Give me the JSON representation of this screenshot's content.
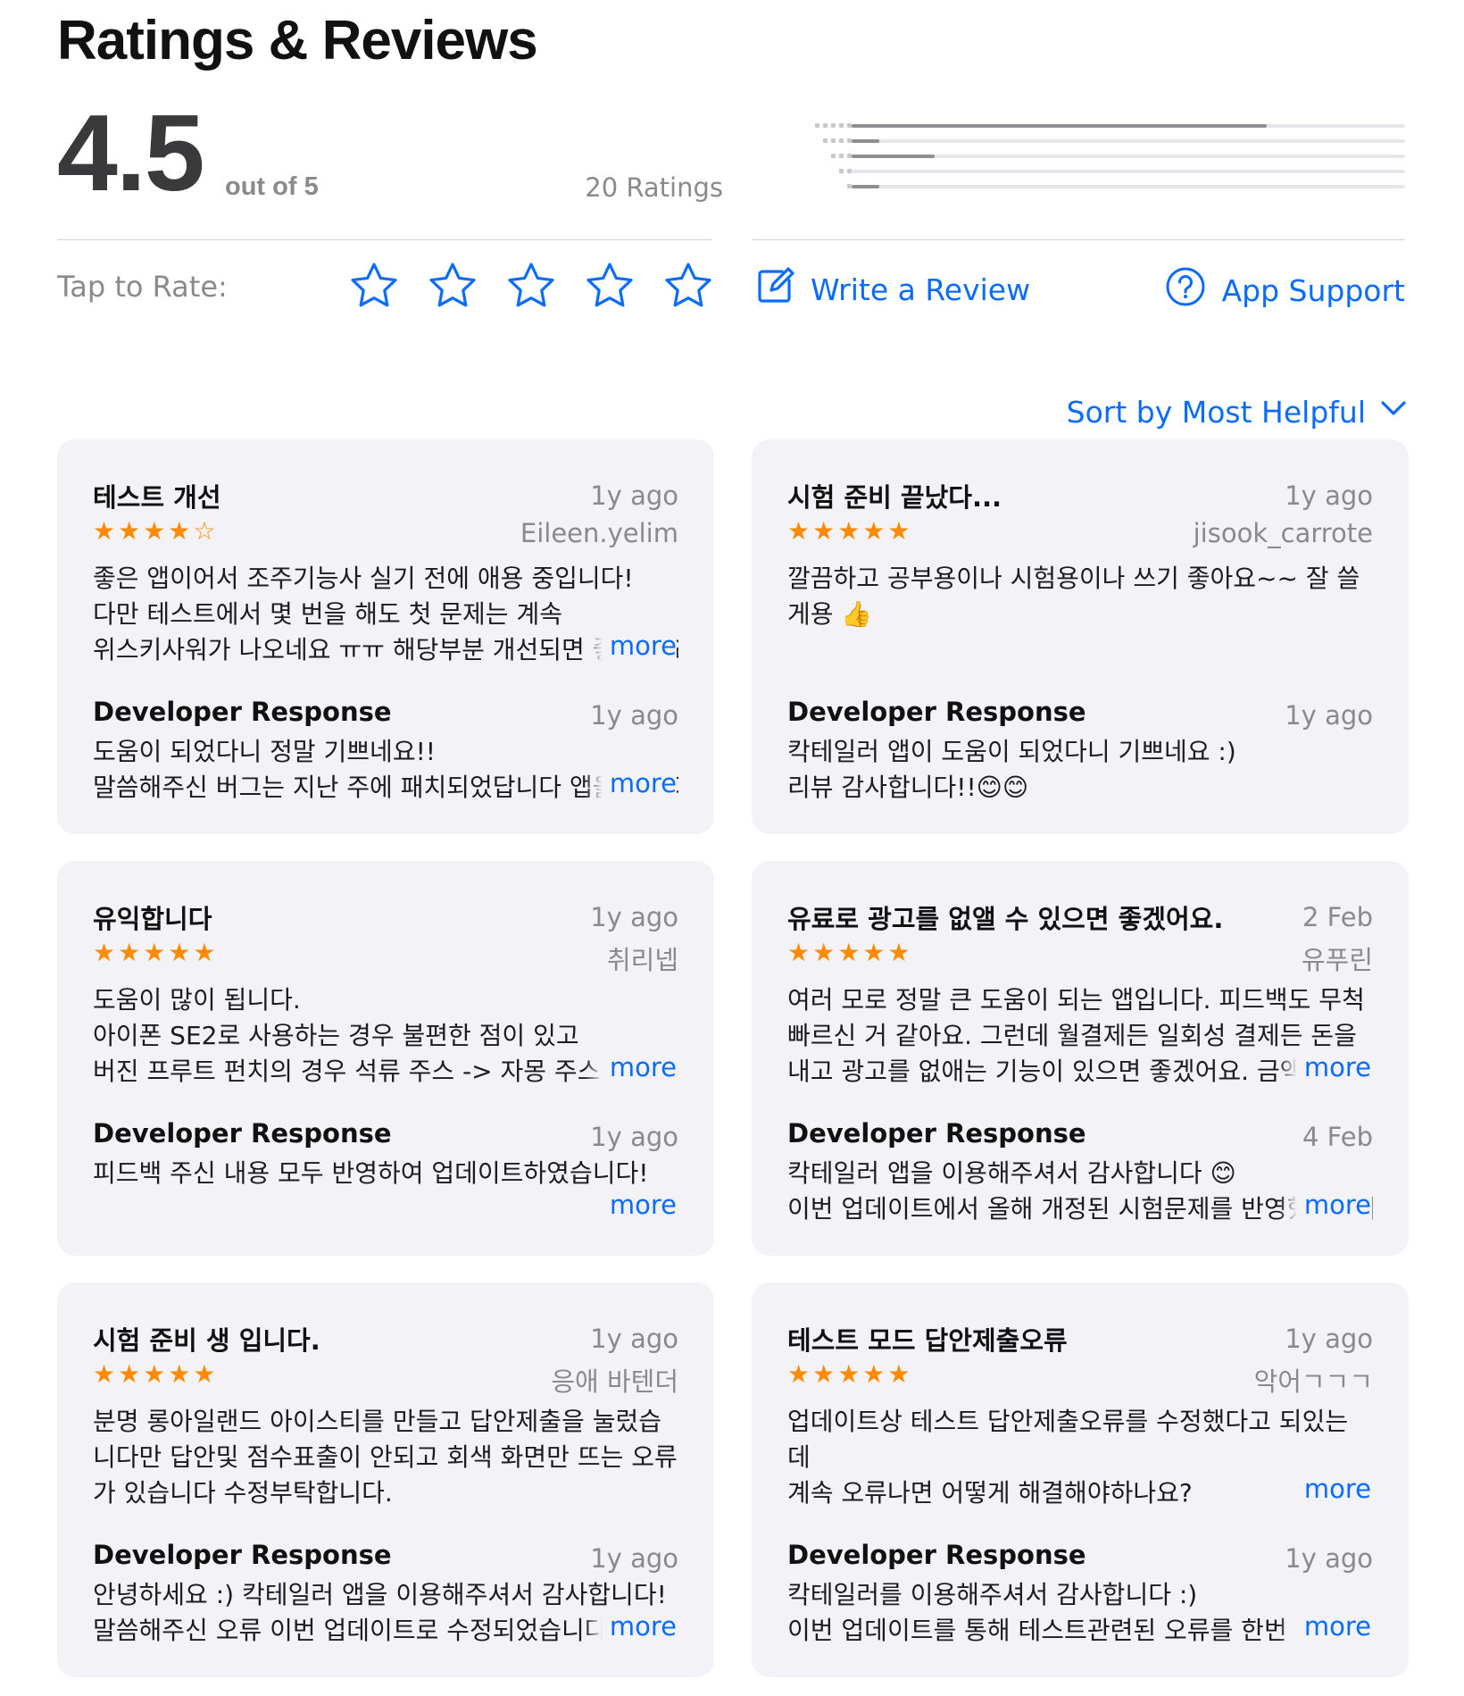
{
  "header": {
    "title": "Ratings & Reviews",
    "rating": "4.5",
    "out_of": "out of 5",
    "ratings_count": "20 Ratings"
  },
  "histogram": [
    {
      "stars": 5,
      "fraction": 0.75
    },
    {
      "stars": 4,
      "fraction": 0.05
    },
    {
      "stars": 3,
      "fraction": 0.15
    },
    {
      "stars": 2,
      "fraction": 0.0
    },
    {
      "stars": 1,
      "fraction": 0.05
    }
  ],
  "actions": {
    "tap_to_rate": "Tap to Rate:",
    "write_review": "Write a Review",
    "app_support": "App Support",
    "sort": "Sort by Most Helpful"
  },
  "colors": {
    "accent": "#0a6cff",
    "star": "#ff8a00",
    "card_bg": "#f2f2f7"
  },
  "reviews": [
    {
      "title": "테스트 개선",
      "date": "1y ago",
      "author": "Eileen.yelim",
      "stars": "★★★★☆",
      "body": [
        "좋은 앱이어서 조주기능사 실기 전에 애용 중입니다!",
        "다만 테스트에서 몇 번을 해도 첫 문제는 계속",
        "위스키사워가 나오네요 ㅠㅠ 해당부분 개선되면 좋겠어요"
      ],
      "body_more": true,
      "dev_label": "Developer Response",
      "dev_date": "1y ago",
      "dev_body": [
        "도움이 되었다니 정말 기쁘네요!!",
        "말씀해주신 버그는 지난 주에 패치되었답니다 앱을 업데이트 해주세요"
      ],
      "dev_more": true,
      "more": "more"
    },
    {
      "title": "시험 준비 끝났다...",
      "date": "1y ago",
      "author": "jisook_carrote",
      "stars": "★★★★★",
      "body": [
        "깔끔하고 공부용이나 시험용이나 쓰기 좋아요~~ 잘 쓸",
        "게용 👍"
      ],
      "body_more": false,
      "dev_label": "Developer Response",
      "dev_date": "1y ago",
      "dev_body": [
        "칵테일러 앱이 도움이 되었다니 기쁘네요 :)",
        "리뷰 감사합니다!!😊😊"
      ],
      "dev_more": false,
      "more": "more"
    },
    {
      "title": "유익합니다",
      "date": "1y ago",
      "author": "취리넵",
      "stars": "★★★★★",
      "body": [
        "도움이 많이 됩니다.",
        "아이폰 SE2로 사용하는 경우 불편한 점이 있고",
        "버진 프루트 펀치의 경우 석류 주스 -> 자몽 주스로 수정"
      ],
      "body_more": true,
      "dev_label": "Developer Response",
      "dev_date": "1y ago",
      "dev_body": [
        "피드백 주신 내용 모두 반영하여 업데이트하였습니다!"
      ],
      "dev_more": true,
      "more": "more"
    },
    {
      "title": "유료로 광고를 없앨 수 있으면 좋겠어요.",
      "date": "2 Feb",
      "author": "유푸린",
      "stars": "★★★★★",
      "body": [
        "여러 모로 정말 큰 도움이 되는 앱입니다. 피드백도 무척",
        "빠르신 거 같아요. 그런데 월결제든 일회성 결제든 돈을",
        "내고 광고를 없애는 기능이 있으면 좋겠어요. 금액이"
      ],
      "body_more": true,
      "dev_label": "Developer Response",
      "dev_date": "4 Feb",
      "dev_body": [
        "칵테일러 앱을 이용해주셔서 감사합니다 😊",
        "이번 업데이트에서 올해 개정된 시험문제를 반영했습니다"
      ],
      "dev_more": true,
      "more": "more"
    },
    {
      "title": "시험 준비 생 입니다.",
      "date": "1y ago",
      "author": "응애 바텐더",
      "stars": "★★★★★",
      "body": [
        "분명 롱아일랜드 아이스티를 만들고 답안제출을 눌렀습",
        "니다만 답안및 점수표출이 안되고 회색 화면만 뜨는 오류",
        "가 있습니다 수정부탁합니다."
      ],
      "body_more": false,
      "dev_label": "Developer Response",
      "dev_date": "1y ago",
      "dev_body": [
        "안녕하세요 :) 칵테일러 앱을 이용해주셔서 감사합니다!",
        "말씀해주신 오류 이번 업데이트로 수정되었습니다"
      ],
      "dev_more": true,
      "more": "more"
    },
    {
      "title": "테스트 모드 답안제출오류",
      "date": "1y ago",
      "author": "악어ㄱㄱㄱ",
      "stars": "★★★★★",
      "body": [
        "업데이트상 테스트 답안제출오류를 수정했다고 되있는",
        "데",
        "계속 오류나면 어떻게 해결해야하나요?"
      ],
      "body_more": true,
      "dev_label": "Developer Response",
      "dev_date": "1y ago",
      "dev_body": [
        "칵테일러를 이용해주셔서 감사합니다 :)",
        "이번 업데이트를 통해 테스트관련된 오류를 한번 더"
      ],
      "dev_more": true,
      "more": "more"
    }
  ]
}
